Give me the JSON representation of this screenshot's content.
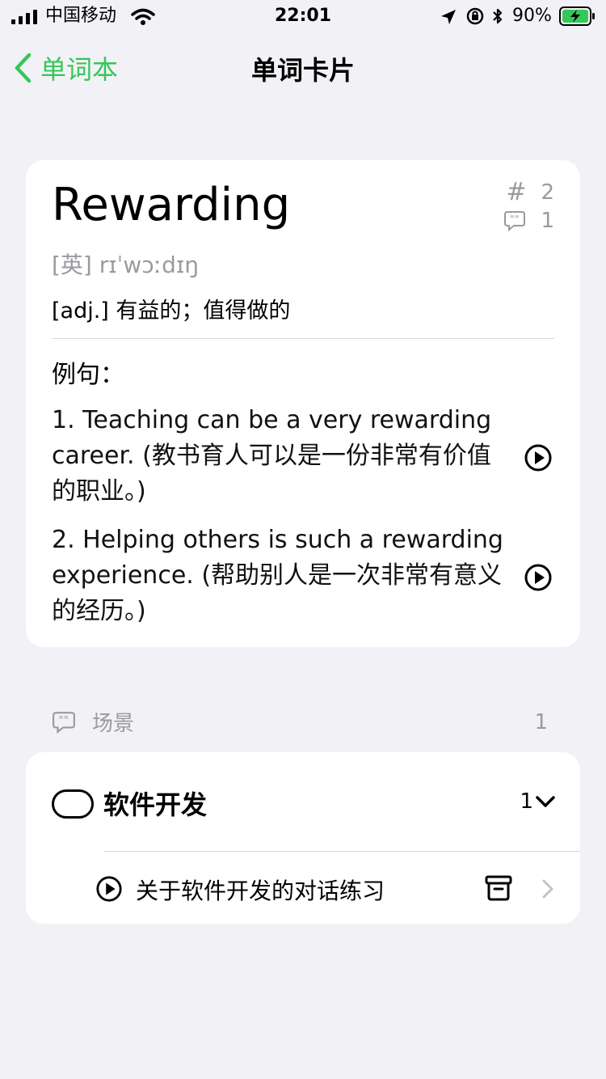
{
  "status_bar": {
    "carrier": "中国移动",
    "time": "22:01",
    "battery": "90%"
  },
  "nav": {
    "back_label": "单词本",
    "title": "单词卡片"
  },
  "word_card": {
    "word": "Rewarding",
    "tag_count": "2",
    "comment_count": "1",
    "phonetic": "[英] rɪˈwɔːdɪŋ",
    "definition": "[adj.] 有益的；值得做的",
    "examples_label": "例句：",
    "examples": [
      "1. Teaching can be a very rewarding career. (教书育人可以是一份非常有价值的职业。)",
      "2. Helping others is such a rewarding experience. (帮助别人是一次非常有意义的经历。)"
    ]
  },
  "scenes_section": {
    "label": "场景",
    "count": "1"
  },
  "scene_card": {
    "title": "软件开发",
    "count": "1",
    "conversation": "关于软件开发的对话练习"
  },
  "colors": {
    "accent": "#34c759",
    "background": "#f2f2f6",
    "card": "#ffffff",
    "secondary_text": "#9a9a9f"
  }
}
